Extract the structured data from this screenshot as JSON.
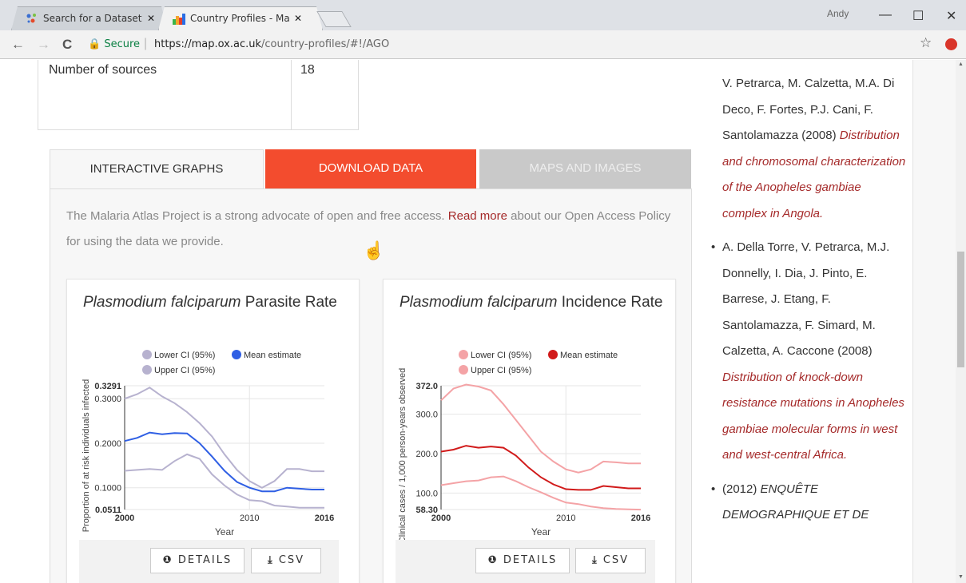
{
  "browser": {
    "tabs": [
      {
        "label": "Search for a Dataset - Hu",
        "close": "✕"
      },
      {
        "label": "Country Profiles - Malaria",
        "close": "✕"
      }
    ],
    "user": "Andy",
    "window_buttons": {
      "min": "—",
      "max": "☐",
      "close": "✕"
    },
    "nav": {
      "back": "←",
      "forward": "→",
      "reload": "C"
    },
    "secure_label": "Secure",
    "url_host": "https://map.ox.ac.uk",
    "url_path": "/country-profiles/#!/AGO",
    "star": "☆"
  },
  "sources": {
    "label": "Number of sources",
    "value": "18"
  },
  "tabs": {
    "interactive": "INTERACTIVE GRAPHS",
    "download": "DOWNLOAD DATA",
    "maps": "MAPS AND IMAGES"
  },
  "intro": {
    "before": "The Malaria Atlas Project is a strong advocate of open and free access. ",
    "link": "Read more",
    "after": " about our Open Access Policy for using the data we provide."
  },
  "cards": [
    {
      "title_italic": "Plasmodium falciparum",
      "title_rest": " Parasite Rate",
      "details": "DETAILS",
      "csv": "CSV"
    },
    {
      "title_italic": "Plasmodium falciparum",
      "title_rest": " Incidence Rate",
      "details": "DETAILS",
      "csv": "CSV"
    }
  ],
  "chart_data": [
    {
      "type": "line",
      "title": "Plasmodium falciparum Parasite Rate",
      "xlabel": "Year",
      "ylabel": "Proportion of at risk individuals infected",
      "xlim": [
        2000,
        2016
      ],
      "ylim": [
        0.0511,
        0.3291
      ],
      "x_ticks": [
        "2000",
        "2010",
        "2016"
      ],
      "y_ticks": [
        "0.3291",
        "0.3000",
        "0.2000",
        "0.1000",
        "0.0511"
      ],
      "legend": [
        "Lower CI (95%)",
        "Mean estimate",
        "Upper CI (95%)"
      ],
      "colors": {
        "ci": "#b7b2cf",
        "mean": "#2f5fe4"
      },
      "x": [
        2000,
        2001,
        2002,
        2003,
        2004,
        2005,
        2006,
        2007,
        2008,
        2009,
        2010,
        2011,
        2012,
        2013,
        2014,
        2015,
        2016
      ],
      "series": [
        {
          "name": "Upper CI (95%)",
          "values": [
            0.3,
            0.31,
            0.325,
            0.305,
            0.29,
            0.27,
            0.245,
            0.215,
            0.175,
            0.14,
            0.115,
            0.1,
            0.115,
            0.142,
            0.142,
            0.137,
            0.137
          ]
        },
        {
          "name": "Mean estimate",
          "values": [
            0.205,
            0.212,
            0.224,
            0.22,
            0.223,
            0.222,
            0.2,
            0.17,
            0.138,
            0.113,
            0.1,
            0.092,
            0.092,
            0.1,
            0.098,
            0.096,
            0.096
          ]
        },
        {
          "name": "Lower CI (95%)",
          "values": [
            0.138,
            0.14,
            0.142,
            0.14,
            0.16,
            0.175,
            0.165,
            0.13,
            0.105,
            0.085,
            0.072,
            0.07,
            0.06,
            0.058,
            0.055,
            0.055,
            0.055
          ]
        }
      ]
    },
    {
      "type": "line",
      "title": "Plasmodium falciparum Incidence Rate",
      "xlabel": "Year",
      "ylabel": "Clinical cases / 1,000 person-years observed",
      "xlim": [
        2000,
        2016
      ],
      "ylim": [
        58.3,
        372.0
      ],
      "x_ticks": [
        "2000",
        "2010",
        "2016"
      ],
      "y_ticks": [
        "372.0",
        "300.0",
        "200.0",
        "100.0",
        "58.30"
      ],
      "legend": [
        "Lower CI (95%)",
        "Mean estimate",
        "Upper CI (95%)"
      ],
      "colors": {
        "ci": "#f4a3a6",
        "mean": "#d11a1a"
      },
      "x": [
        2000,
        2001,
        2002,
        2003,
        2004,
        2005,
        2006,
        2007,
        2008,
        2009,
        2010,
        2011,
        2012,
        2013,
        2014,
        2015,
        2016
      ],
      "series": [
        {
          "name": "Upper CI (95%)",
          "values": [
            335,
            365,
            375,
            370,
            360,
            325,
            285,
            245,
            205,
            180,
            160,
            152,
            160,
            180,
            178,
            175,
            175
          ]
        },
        {
          "name": "Mean estimate",
          "values": [
            205,
            210,
            220,
            215,
            218,
            215,
            195,
            165,
            140,
            122,
            110,
            108,
            108,
            118,
            115,
            112,
            112
          ]
        },
        {
          "name": "Lower CI (95%)",
          "values": [
            120,
            125,
            130,
            132,
            140,
            142,
            130,
            115,
            102,
            88,
            76,
            72,
            66,
            62,
            60,
            59,
            58
          ]
        }
      ]
    }
  ],
  "references": {
    "ref1_authors": "V. Petrarca, M. Calzetta, M.A. Di Deco, F. Fortes, P.J. Cani, F. Santolamazza",
    "ref1_year": "(2008) ",
    "ref1_title": "Distribution and chromosomal characterization of the Anopheles gambiae complex in Angola.",
    "ref2_authors": "A. Della Torre, V. Petrarca, M.J. Donnelly, I. Dia, J. Pinto, E. Barrese, J. Etang, F. Santolamazza, F. Simard, M. Calzetta, A. Caccone",
    "ref2_year": "(2008) ",
    "ref2_title": "Distribution of knock-down resistance mutations in Anopheles gambiae molecular forms in west and west-central Africa.",
    "ref3_year": "(2012) ",
    "ref3_title": "ENQUÊTE DEMOGRAPHIQUE ET DE",
    "bullet": "•"
  }
}
